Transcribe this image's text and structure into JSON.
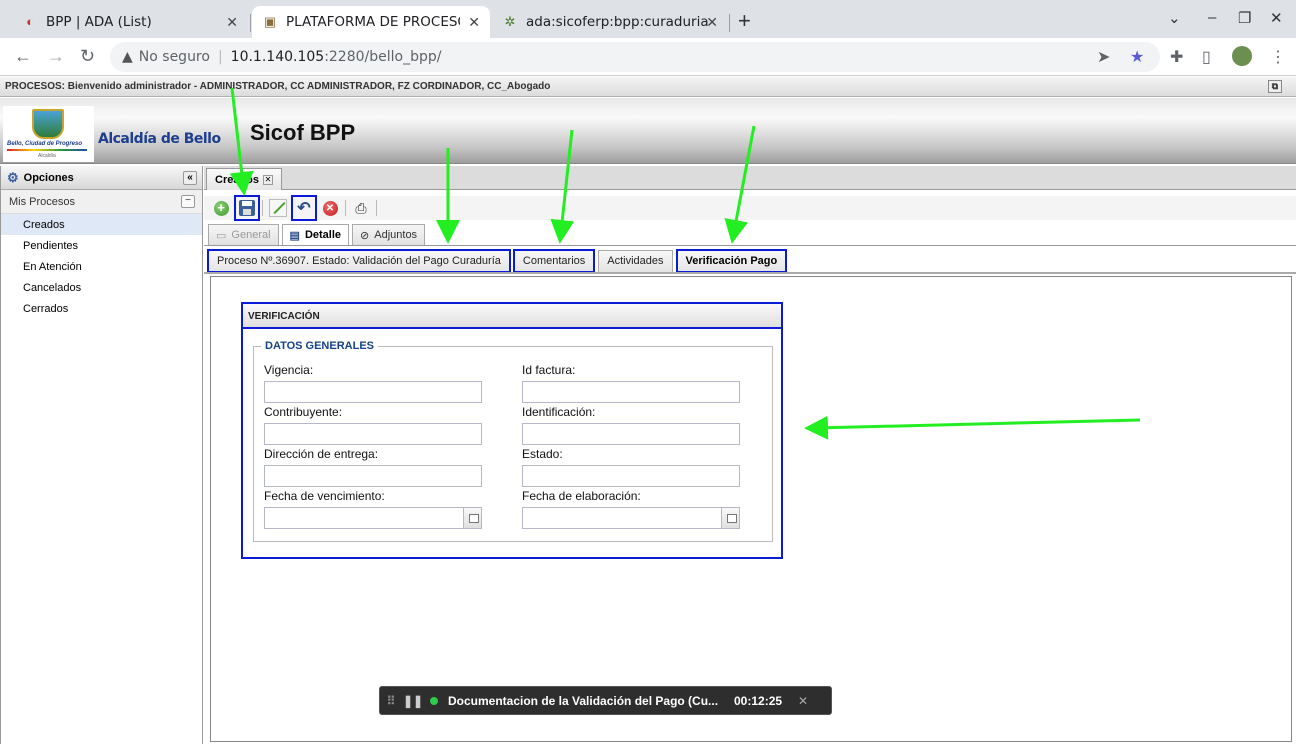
{
  "browser": {
    "tabs": [
      {
        "title": "BPP | ADA (List)",
        "icon": "redmine-icon"
      },
      {
        "title": "PLATAFORMA DE PROCESOS",
        "icon": "app-icon"
      },
      {
        "title": "ada:sicoferp:bpp:curaduria",
        "icon": "wiki-icon"
      }
    ],
    "new_tab": "+",
    "address": {
      "insecure_label": "No seguro",
      "host": "10.1.140.105",
      "rest": ":2280/bello_bpp/"
    }
  },
  "app": {
    "welcome_text": "PROCESOS: Bienvenido administrador - ADMINISTRADOR, CC ADMINISTRADOR, FZ CORDINADOR, CC_Abogado",
    "logo_caption": "Bello, Ciudad de Progreso",
    "logo_sub": "Alcaldía",
    "org_name": "Alcaldía de Bello",
    "app_title": "Sicof BPP"
  },
  "sidebar": {
    "header": "Opciones",
    "collapse_glyph": "«",
    "group": "Mis Procesos",
    "items": [
      "Creados",
      "Pendientes",
      "En Atención",
      "Cancelados",
      "Cerrados"
    ]
  },
  "main": {
    "tab_label": "Creados",
    "subtabs": [
      "General",
      "Detalle",
      "Adjuntos"
    ],
    "process_tabs": [
      "Proceso Nº.36907. Estado: Validación del Pago Curaduría",
      "Comentarios",
      "Actividades",
      "Verificación Pago"
    ]
  },
  "verificacion": {
    "title": "VERIFICACIÓN",
    "legend": "DATOS GENERALES",
    "fields": {
      "vigencia": {
        "label": "Vigencia:",
        "value": ""
      },
      "id_factura": {
        "label": "Id factura:",
        "value": ""
      },
      "contribuyente": {
        "label": "Contribuyente:",
        "value": ""
      },
      "identificacion": {
        "label": "Identificación:",
        "value": ""
      },
      "direccion": {
        "label": "Dirección de entrega:",
        "value": ""
      },
      "estado": {
        "label": "Estado:",
        "value": ""
      },
      "fecha_vencimiento": {
        "label": "Fecha de vencimiento:",
        "value": ""
      },
      "fecha_elaboracion": {
        "label": "Fecha de elaboración:",
        "value": ""
      }
    }
  },
  "recorder": {
    "title": "Documentacion de la Validación del Pago (Cu...",
    "timer": "00:12:25"
  },
  "colors": {
    "highlight": "#0a1bd6",
    "arrow": "#22ee22"
  }
}
